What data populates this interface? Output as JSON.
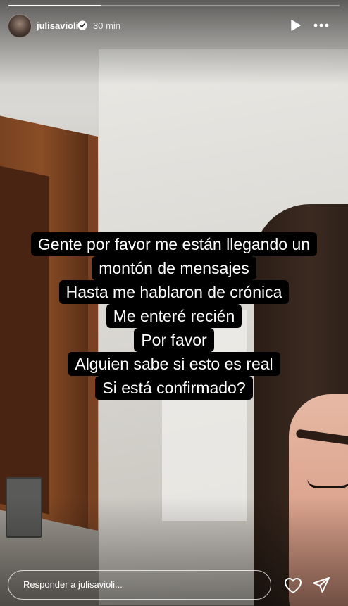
{
  "story": {
    "username": "julisavioli",
    "time_ago": "30 min",
    "progress_fraction": 0.28,
    "caption_lines": [
      "Gente por favor me están llegando un",
      "montón de mensajes",
      "Hasta me hablaron de crónica",
      "Me enteré recién",
      "Por favor",
      "Alguien sabe si esto es real",
      "Si está confirmado?"
    ]
  },
  "footer": {
    "reply_placeholder": "Responder a julisavioli..."
  },
  "icons": {
    "verified": "verified-badge-icon",
    "play": "play-icon",
    "more": "more-options-icon",
    "like": "heart-icon",
    "share": "send-icon"
  },
  "colors": {
    "caption_bg": "#000000",
    "text": "#ffffff"
  }
}
